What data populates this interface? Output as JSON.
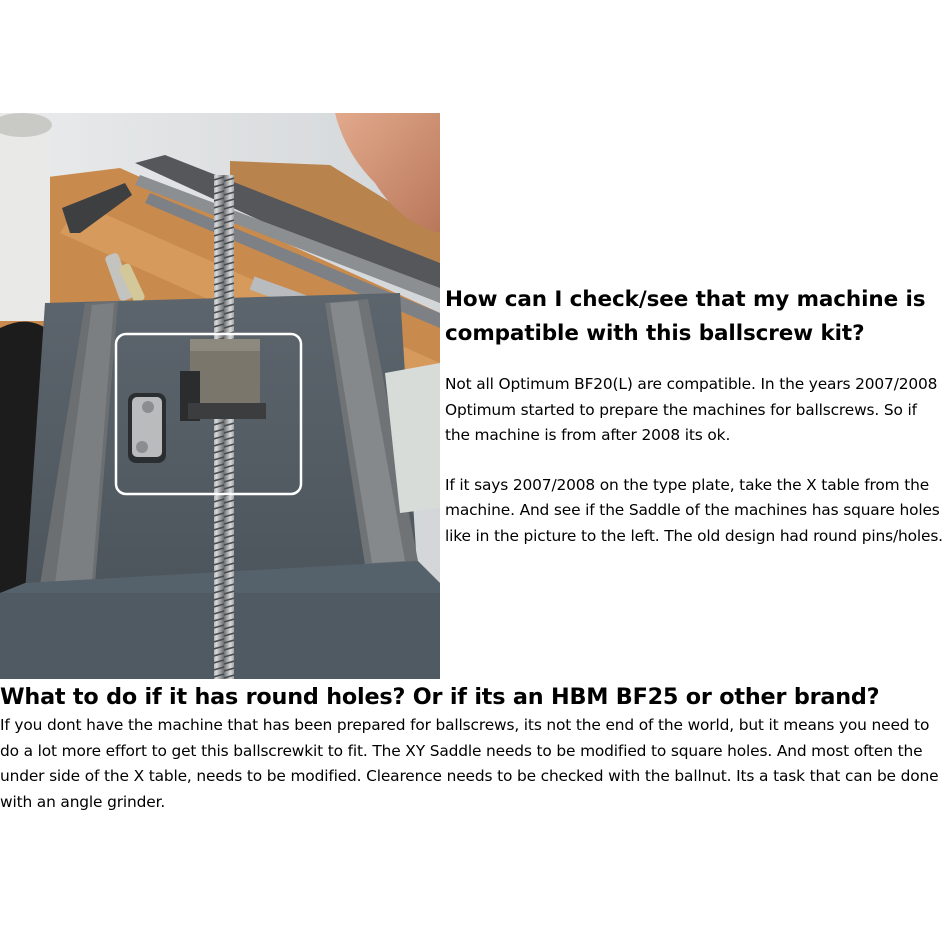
{
  "colors": {
    "text": "#000000",
    "background": "#ffffff",
    "highlight_box": "#ffffff"
  },
  "intro": {
    "title": "How can I check/see that my machine is compatible with this ballscrew kit?",
    "paragraph1": "Not all Optimum BF20(L) are compatible. In the years 2007/2008 Optimum started to prepare the machines for ballscrews. So if the machine is from after 2008 its ok.",
    "paragraph2": "If it says 2007/2008 on the type plate, take the X table from the machine. And see if the Saddle of the machines has square holes like in the picture to the left. The old design had round pins/holes."
  },
  "round_holes": {
    "title": "What to do if it has round holes? Or if its an HBM BF25 or other brand?",
    "text": "If you dont have the machine that has been prepared for ballscrews, its not the end of the world, but it means you need to do a lot more effort to get this ballscrewkit to fit. The XY Saddle needs to be modified to square holes. And most often the under side of the X table, needs to be modified. Clearence needs to be checked with the ballnut. Its a task that can be done with an angle grinder."
  }
}
